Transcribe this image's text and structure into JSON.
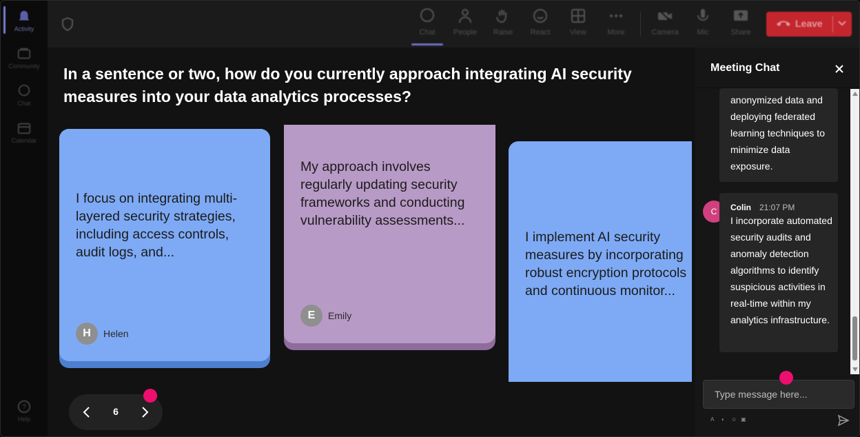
{
  "rail": {
    "items": [
      {
        "label": "Activity",
        "icon": "bell-icon"
      },
      {
        "label": "Community",
        "icon": "community-icon"
      },
      {
        "label": "Chat",
        "icon": "chat-icon"
      },
      {
        "label": "Calendar",
        "icon": "calendar-icon"
      },
      {
        "label": "Help",
        "icon": "help-icon"
      }
    ]
  },
  "toolbar": {
    "buttons": [
      {
        "label": "Chat",
        "icon": "chat-icon"
      },
      {
        "label": "People",
        "icon": "people-icon"
      },
      {
        "label": "Raise",
        "icon": "hand-icon"
      },
      {
        "label": "React",
        "icon": "smile-icon"
      },
      {
        "label": "View",
        "icon": "grid-icon"
      },
      {
        "label": "More",
        "icon": "more-icon"
      },
      {
        "label": "Camera",
        "icon": "camera-off-icon"
      },
      {
        "label": "Mic",
        "icon": "mic-icon"
      },
      {
        "label": "Share",
        "icon": "share-icon"
      }
    ],
    "leave_label": "Leave",
    "leave_color": "#c4262e"
  },
  "question": "In a sentence or two, how do you currently approach integrating AI security measures into your data analytics processes?",
  "cards": [
    {
      "text": "I focus on integrating multi-layered security strategies, including access controls, audit logs, and...",
      "author": "Helen",
      "initial": "H",
      "color": "#7eaaf5"
    },
    {
      "text": "My approach involves regularly updating security frameworks and conducting vulnerability assessments...",
      "author": "Emily",
      "initial": "E",
      "color": "#b89ac6"
    },
    {
      "text": "I implement AI security measures by incorporating robust encryption protocols and continuous monitor...",
      "author": "",
      "initial": "",
      "color": "#7eaaf5"
    }
  ],
  "pager": {
    "page": "6"
  },
  "chat": {
    "title": "Meeting Chat",
    "messages": [
      {
        "text": "anonymized data and deploying federated learning techniques to minimize data exposure."
      },
      {
        "sender": "Colin",
        "initial": "C",
        "time": "21:07 PM",
        "text": "I incorporate automated security audits and anomaly detection algorithms to identify suspicious activities in real-time within my analytics infrastructure."
      }
    ],
    "input_placeholder": "Type message here..."
  },
  "accent": "#ec0f6e"
}
